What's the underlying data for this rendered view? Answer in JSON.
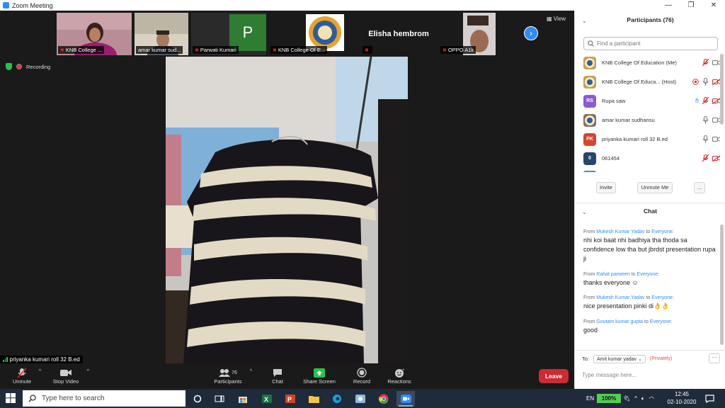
{
  "window": {
    "title": "Zoom Meeting",
    "buttons": [
      "—",
      "❐",
      "✕"
    ]
  },
  "gallery_strip": {
    "tiles": [
      {
        "name": "KNB College ...",
        "muted": true
      },
      {
        "name": "amar kumar sud...",
        "muted": false
      },
      {
        "name": "Parwati Kumari",
        "muted": true,
        "initial": "P"
      },
      {
        "name": "KNB College Of E...",
        "muted": true
      },
      {
        "name": "Elisha hembrom",
        "muted": true
      },
      {
        "name": "OPPO A1k",
        "muted": true
      }
    ],
    "view_label": "View"
  },
  "status": {
    "recording_label": "Recording"
  },
  "active_speaker": {
    "name": "priyanka kumari roll 32 B.ed"
  },
  "toolbar": {
    "unmute": "Unmute",
    "stop_video": "Stop Video",
    "participants": "Participants",
    "participants_count": "76",
    "chat": "Chat",
    "share_screen": "Share Screen",
    "record": "Record",
    "reactions": "Reactions",
    "leave": "Leave"
  },
  "participants_panel": {
    "title": "Participants (76)",
    "search_placeholder": "Find a participant",
    "rows": [
      {
        "name": "KNB College Of Education (Me)",
        "avatar_text": "",
        "avatar_color": "#c8a24a",
        "hand": false,
        "mic_muted": true,
        "cam_off": false,
        "host_icon": false
      },
      {
        "name": "KNB College Of Educa...  (Host)",
        "avatar_text": "",
        "avatar_color": "#c8a24a",
        "hand": false,
        "mic_muted": false,
        "cam_off": true,
        "host_icon": true
      },
      {
        "name": "Rupa saw",
        "avatar_text": "RS",
        "avatar_color": "#8a5bd1",
        "hand": true,
        "mic_muted": true,
        "cam_off": true,
        "host_icon": false
      },
      {
        "name": "amar kumar sudhansu",
        "avatar_text": "",
        "avatar_color": "#8a7060",
        "hand": false,
        "mic_muted": false,
        "cam_off": false,
        "host_icon": false
      },
      {
        "name": "priyanka kumari roll 32 B.ed",
        "avatar_text": "PK",
        "avatar_color": "#d5462f",
        "hand": false,
        "mic_muted": false,
        "cam_off": false,
        "host_icon": false
      },
      {
        "name": "061454",
        "avatar_text": "0",
        "avatar_color": "#25456b",
        "hand": false,
        "mic_muted": true,
        "cam_off": true,
        "host_icon": false
      }
    ],
    "invite": "Invite",
    "unmute_me": "Unmute Me",
    "more": "..."
  },
  "chat_panel": {
    "title": "Chat",
    "from_word": "From",
    "to_word": "to",
    "messages": [
      {
        "from": "Mukesh Kumar Yadav",
        "to": "Everyone:",
        "text": "nhi koi baat nhi badhiya tha thoda sa confidence low tha but jbrdst presentation rupa ji"
      },
      {
        "from": "Rahat parween",
        "to": "Everyone:",
        "text": "thanks everyone ☺"
      },
      {
        "from": "Mukesh Kumar Yadav",
        "to": "Everyone:",
        "text": "nice presentation pinki di👌👌"
      },
      {
        "from": "Goutam kumar gupta",
        "to": "Everyone:",
        "text": "good"
      }
    ],
    "to_label": "To:",
    "recipient": "Amit kumar yadav",
    "privately": "(Privately)",
    "input_placeholder": "Type message here..."
  },
  "taskbar": {
    "search_placeholder": "Type here to search",
    "language": "EN",
    "battery": "100%",
    "time": "12:45",
    "date": "02-10-2020"
  },
  "colors": {
    "zoom_blue": "#2d8cff",
    "leave_red": "#cd2b31",
    "muted_red": "#e02828",
    "share_green": "#23c552"
  }
}
